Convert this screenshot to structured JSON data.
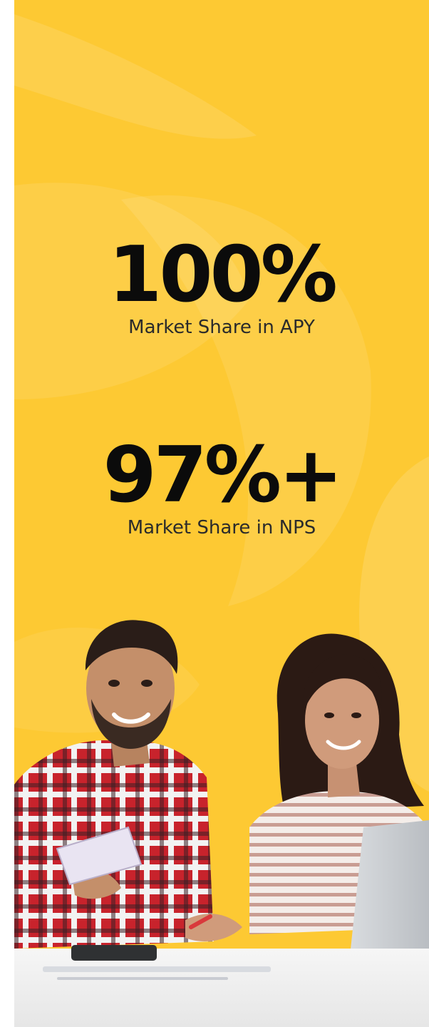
{
  "stats": [
    {
      "value": "100%",
      "label": "Market Share in APY"
    },
    {
      "value": "97%+",
      "label": "Market Share in NPS"
    }
  ],
  "colors": {
    "background": "#fdc933",
    "text_primary": "#0b0b0b",
    "text_secondary": "#2b2b2b"
  },
  "photo": {
    "subject": "two-people-with-laptop-and-cash"
  }
}
